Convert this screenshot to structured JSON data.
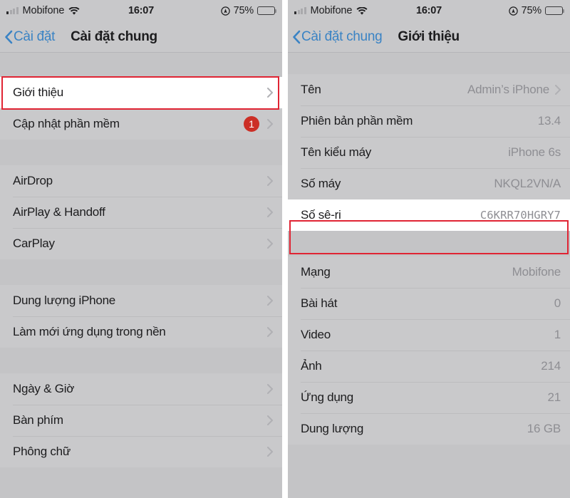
{
  "statusbar": {
    "carrier": "Mobifone",
    "time": "16:07",
    "battery_percent": "75%",
    "signal_icon": "cellular-signal-icon",
    "wifi_icon": "wifi-icon",
    "location_icon": "location-services-icon",
    "battery_icon": "battery-icon"
  },
  "left_screen": {
    "nav": {
      "back_label": "Cài đặt",
      "title": "Cài đặt chung",
      "back_icon": "chevron-left-icon"
    },
    "groups": [
      {
        "rows": [
          {
            "label": "Giới thiệu",
            "value": "",
            "badge": "",
            "chevron": true,
            "highlighted": true
          },
          {
            "label": "Cập nhật phần mềm",
            "value": "",
            "badge": "1",
            "chevron": true,
            "highlighted": false
          }
        ]
      },
      {
        "rows": [
          {
            "label": "AirDrop",
            "value": "",
            "badge": "",
            "chevron": true,
            "highlighted": false
          },
          {
            "label": "AirPlay & Handoff",
            "value": "",
            "badge": "",
            "chevron": true,
            "highlighted": false
          },
          {
            "label": "CarPlay",
            "value": "",
            "badge": "",
            "chevron": true,
            "highlighted": false
          }
        ]
      },
      {
        "rows": [
          {
            "label": "Dung lượng iPhone",
            "value": "",
            "badge": "",
            "chevron": true,
            "highlighted": false
          },
          {
            "label": "Làm mới ứng dụng trong nền",
            "value": "",
            "badge": "",
            "chevron": true,
            "highlighted": false
          }
        ]
      },
      {
        "rows": [
          {
            "label": "Ngày & Giờ",
            "value": "",
            "badge": "",
            "chevron": true,
            "highlighted": false
          },
          {
            "label": "Bàn phím",
            "value": "",
            "badge": "",
            "chevron": true,
            "highlighted": false
          },
          {
            "label": "Phông chữ",
            "value": "",
            "badge": "",
            "chevron": true,
            "highlighted": false
          }
        ]
      }
    ]
  },
  "right_screen": {
    "nav": {
      "back_label": "Cài đặt chung",
      "title": "Giới thiệu",
      "back_icon": "chevron-left-icon"
    },
    "groups": [
      {
        "rows": [
          {
            "label": "Tên",
            "value": "Admin’s iPhone",
            "mono": false,
            "chevron": true,
            "highlighted": false
          },
          {
            "label": "Phiên bản phần mềm",
            "value": "13.4",
            "mono": false,
            "chevron": false,
            "highlighted": false
          },
          {
            "label": "Tên kiểu máy",
            "value": "iPhone 6s",
            "mono": false,
            "chevron": false,
            "highlighted": false
          },
          {
            "label": "Số máy",
            "value": "NKQL2VN/A",
            "mono": false,
            "chevron": false,
            "highlighted": false
          },
          {
            "label": "Số sê-ri",
            "value": "C6KRR70HGRY7",
            "mono": true,
            "chevron": false,
            "highlighted": true
          }
        ]
      },
      {
        "rows": [
          {
            "label": "Mạng",
            "value": "Mobifone",
            "mono": false,
            "chevron": false,
            "highlighted": false
          },
          {
            "label": "Bài hát",
            "value": "0",
            "mono": false,
            "chevron": false,
            "highlighted": false
          },
          {
            "label": "Video",
            "value": "1",
            "mono": false,
            "chevron": false,
            "highlighted": false
          },
          {
            "label": "Ảnh",
            "value": "214",
            "mono": false,
            "chevron": false,
            "highlighted": false
          },
          {
            "label": "Ứng dụng",
            "value": "21",
            "mono": false,
            "chevron": false,
            "highlighted": false
          },
          {
            "label": "Dung lượng",
            "value": "16 GB",
            "mono": false,
            "chevron": false,
            "highlighted": false
          }
        ]
      }
    ]
  },
  "annotations": {
    "accent_color": "#e02433",
    "highlight_left": "Giới thiệu",
    "highlight_right": "Số sê-ri"
  },
  "colors": {
    "page_background": "#c4c4c6",
    "row_background": "#c9c9cb",
    "nav_background": "#c8c8ca",
    "link_blue": "#3a83c4",
    "badge_red": "#cc2f26",
    "value_grey": "#8e8e93",
    "annotation_red": "#e02433"
  }
}
